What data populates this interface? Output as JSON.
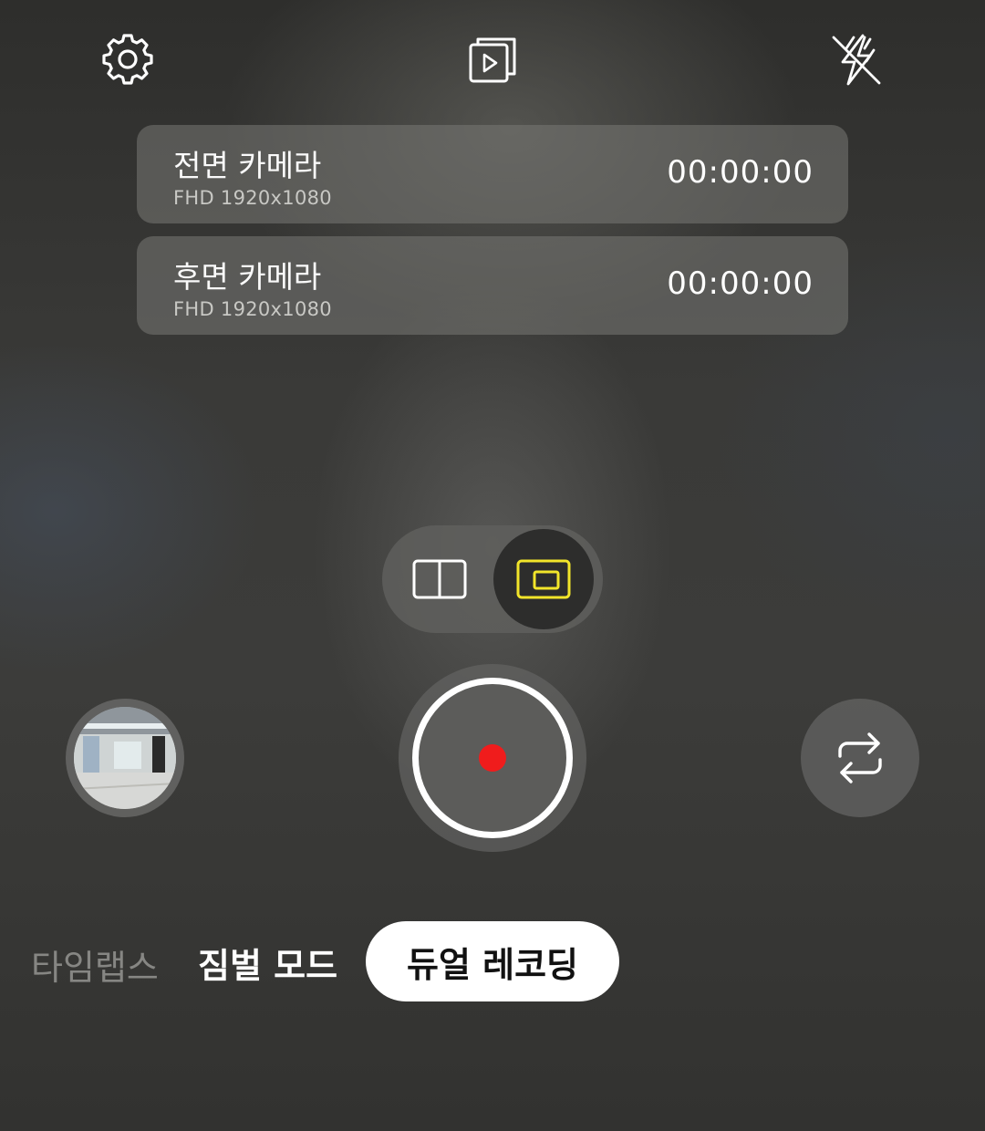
{
  "top_bar": {
    "settings_icon": "gear-icon",
    "gallery_icon": "gallery-play-icon",
    "flash_icon": "flash-off-icon"
  },
  "cameras": [
    {
      "title": "전면 카메라",
      "resolution": "FHD 1920x1080",
      "time": "00:00:00"
    },
    {
      "title": "후면 카메라",
      "resolution": "FHD 1920x1080",
      "time": "00:00:00"
    }
  ],
  "layout_toggle": {
    "options": [
      "split-view-icon",
      "picture-in-picture-icon"
    ],
    "selected": "picture-in-picture-icon",
    "accent_color": "#f2e52a"
  },
  "controls": {
    "record_color": "#f01c1c",
    "switch_icon": "switch-camera-icon"
  },
  "modes": {
    "items": [
      "타임랩스",
      "짐벌 모드",
      "듀얼 레코딩"
    ],
    "active": "듀얼 레코딩"
  }
}
